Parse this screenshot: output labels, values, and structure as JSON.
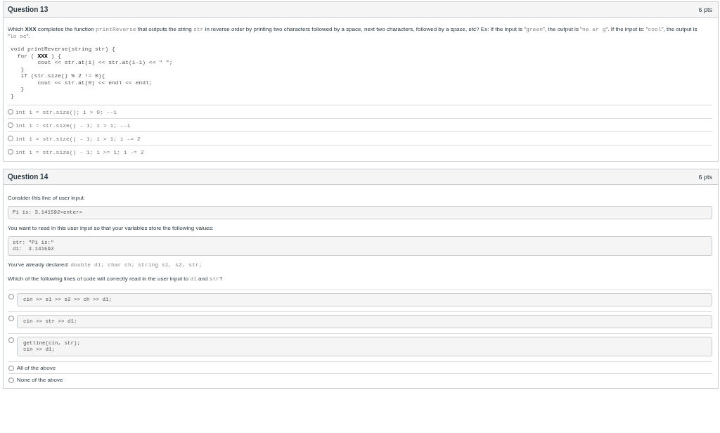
{
  "questions": [
    {
      "title": "Question 13",
      "points": "6 pts",
      "prompt": [
        {
          "kind": "text",
          "text": "Which "
        },
        {
          "kind": "bold",
          "text": "XXX"
        },
        {
          "kind": "text",
          "text": " completes the function "
        },
        {
          "kind": "code",
          "text": "printReverse"
        },
        {
          "kind": "text",
          "text": " that outputs the string "
        },
        {
          "kind": "code",
          "text": "str"
        },
        {
          "kind": "text",
          "text": " in reverse order by printing two characters followed by a space, next two characters, followed by a space, etc? Ex: If the input is \""
        },
        {
          "kind": "code",
          "text": "green"
        },
        {
          "kind": "text",
          "text": "\", the output is \""
        },
        {
          "kind": "code",
          "text": "ne er g"
        },
        {
          "kind": "text",
          "text": "\".  If the input is: \""
        },
        {
          "kind": "code",
          "text": "cool"
        },
        {
          "kind": "text",
          "text": "\", the output is \""
        },
        {
          "kind": "code",
          "text": "lo oc"
        },
        {
          "kind": "text",
          "text": "\"."
        }
      ],
      "code": [
        "void printReverse(string str) {",
        "  for ( **XXX** ) {",
        "        cout << str.at(i) << str.at(i-1) << \" \";",
        "   }",
        "   if (str.size() % 2 != 0){",
        "        cout << str.at(0) << endl << endl;",
        "   }",
        "}"
      ],
      "options": [
        {
          "kind": "inline",
          "lines": [
            "int i = str.size(); i > 0; --i"
          ],
          "selected": false
        },
        {
          "kind": "inline",
          "lines": [
            "int i = str.size() - 1; i > 1; --i"
          ],
          "selected": false
        },
        {
          "kind": "inline",
          "lines": [
            "int i = str.size() - 1; i > 1; i -= 2"
          ],
          "selected": false
        },
        {
          "kind": "inline",
          "lines": [
            "int i = str.size() - 1; i >= 1; i -= 2"
          ],
          "selected": false
        }
      ]
    },
    {
      "title": "Question 14",
      "points": "6 pts",
      "blocks": [
        {
          "kind": "para",
          "parts": [
            {
              "kind": "text",
              "text": "Consider this line of user input:"
            }
          ]
        },
        {
          "kind": "codebox",
          "lines": [
            "Pi is: 3.141592<enter>"
          ]
        },
        {
          "kind": "para",
          "parts": [
            {
              "kind": "text",
              "text": "You want to read in this user input so that your variables store the following values:"
            }
          ]
        },
        {
          "kind": "codebox",
          "lines": [
            "str: \"Pi is:\"",
            "d1:  3.141592"
          ]
        },
        {
          "kind": "para",
          "parts": [
            {
              "kind": "text",
              "text": "You've already declared: "
            },
            {
              "kind": "code",
              "text": "double d1; char ch; string s1, s2, str;"
            }
          ]
        },
        {
          "kind": "para",
          "parts": [
            {
              "kind": "text",
              "text": "Which of the following lines of code will correctly read in the user input to "
            },
            {
              "kind": "code",
              "text": "d1"
            },
            {
              "kind": "text",
              "text": " and "
            },
            {
              "kind": "code",
              "text": "str"
            },
            {
              "kind": "text",
              "text": "?"
            }
          ]
        }
      ],
      "options": [
        {
          "kind": "box",
          "lines": [
            "cin >> s1 >> s2 >> ch >> d1;"
          ],
          "selected": false
        },
        {
          "kind": "box",
          "lines": [
            "cin >> str >> d1;"
          ],
          "selected": false
        },
        {
          "kind": "box",
          "lines": [
            "getline(cin, str);",
            "cin >> d1;"
          ],
          "selected": false
        },
        {
          "kind": "text",
          "lines": [
            "All of the above"
          ],
          "selected": false
        },
        {
          "kind": "text",
          "lines": [
            "None of the above"
          ],
          "selected": false
        }
      ]
    }
  ]
}
